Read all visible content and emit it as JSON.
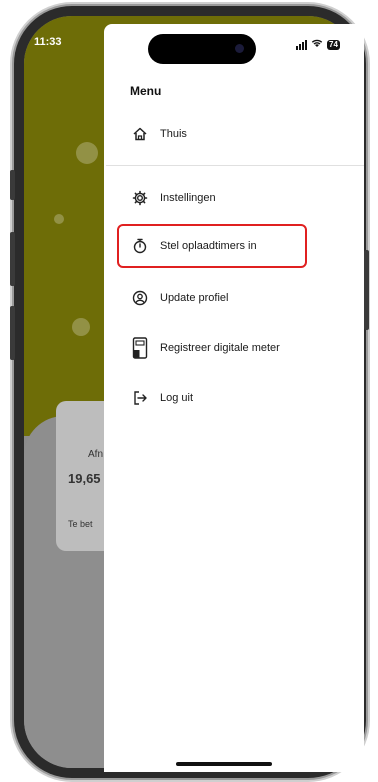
{
  "status": {
    "time": "11:33",
    "battery": "74"
  },
  "menu": {
    "title": "Menu",
    "items": [
      {
        "label": "Thuis",
        "icon": "home-icon"
      },
      {
        "label": "Instellingen",
        "icon": "gear-icon"
      },
      {
        "label": "Stel oplaadtimers in",
        "icon": "timer-icon"
      },
      {
        "label": "Update profiel",
        "icon": "profile-icon"
      },
      {
        "label": "Registreer digitale meter",
        "icon": "meter-icon"
      },
      {
        "label": "Log uit",
        "icon": "logout-icon"
      }
    ]
  },
  "background": {
    "label_1": "Afn",
    "value_1": "19,65",
    "label_2": "Te bet"
  },
  "colors": {
    "highlight": "#e02020",
    "accent_bg": "#6e6d07"
  }
}
